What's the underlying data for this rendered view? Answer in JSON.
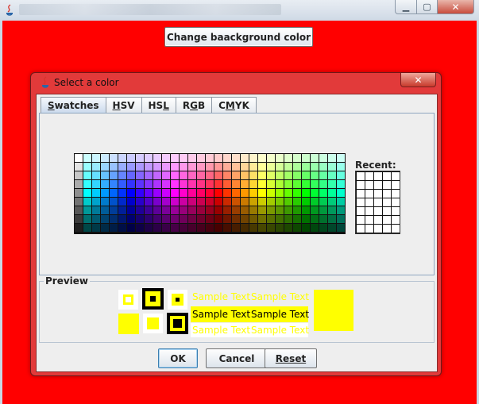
{
  "window": {
    "controls": {
      "minimize": "▁",
      "maximize": "▢",
      "close": "✕"
    }
  },
  "main": {
    "change_bg_label": "Change baackground color"
  },
  "dialog": {
    "title": "Select a color",
    "close": "✕",
    "tabs": [
      {
        "label": "Swatches",
        "mnemonic_index": 0
      },
      {
        "label": "HSV",
        "mnemonic_index": 0
      },
      {
        "label": "HSL",
        "mnemonic_index": 2
      },
      {
        "label": "RGB",
        "mnemonic_index": 1
      },
      {
        "label": "CMYK",
        "mnemonic_index": 1
      }
    ],
    "active_tab": "Swatches",
    "recent_label": "Recent:",
    "preview_label": "Preview",
    "preview": {
      "selected_color": "#ffff00",
      "sample_text": "Sample Text"
    },
    "buttons": {
      "ok": "OK",
      "cancel": "Cancel",
      "reset": "Reset"
    }
  },
  "colors": {
    "background": "#ff0000",
    "accent_tab": "#c9d9ec"
  }
}
